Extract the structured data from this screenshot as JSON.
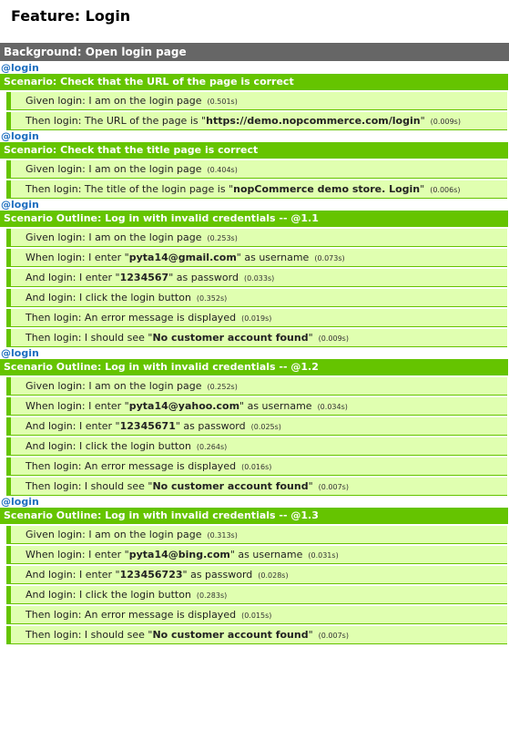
{
  "feature": {
    "title": "Feature: Login"
  },
  "background": {
    "title": "Background: Open login page"
  },
  "scenarios": [
    {
      "tag": "@login",
      "title": "Scenario: Check that the URL of the page is correct",
      "steps": [
        {
          "pre": "Given login: I am on the login page",
          "arg": "",
          "post": "",
          "duration": "(0.501s)"
        },
        {
          "pre": "Then login: The URL of the page is \"",
          "arg": "https://demo.nopcommerce.com/login",
          "post": "\"",
          "duration": "(0.009s)"
        }
      ]
    },
    {
      "tag": "@login",
      "title": "Scenario: Check that the title page is correct",
      "steps": [
        {
          "pre": "Given login: I am on the login page",
          "arg": "",
          "post": "",
          "duration": "(0.404s)"
        },
        {
          "pre": "Then login: The title of the login page is \"",
          "arg": "nopCommerce demo store. Login",
          "post": "\"",
          "duration": "(0.006s)"
        }
      ]
    },
    {
      "tag": "@login",
      "title": "Scenario Outline: Log in with invalid credentials -- @1.1",
      "steps": [
        {
          "pre": "Given login: I am on the login page",
          "arg": "",
          "post": "",
          "duration": "(0.253s)"
        },
        {
          "pre": "When login: I enter \"",
          "arg": "pyta14@gmail.com",
          "post": "\" as username",
          "duration": "(0.073s)"
        },
        {
          "pre": "And login: I enter \"",
          "arg": "1234567",
          "post": "\" as password",
          "duration": "(0.033s)"
        },
        {
          "pre": "And login: I click the login button",
          "arg": "",
          "post": "",
          "duration": "(0.352s)"
        },
        {
          "pre": "Then login: An error message is displayed",
          "arg": "",
          "post": "",
          "duration": "(0.019s)"
        },
        {
          "pre": "Then login: I should see \"",
          "arg": "No customer account found",
          "post": "\"",
          "duration": "(0.009s)"
        }
      ]
    },
    {
      "tag": "@login",
      "title": "Scenario Outline: Log in with invalid credentials -- @1.2",
      "steps": [
        {
          "pre": "Given login: I am on the login page",
          "arg": "",
          "post": "",
          "duration": "(0.252s)"
        },
        {
          "pre": "When login: I enter \"",
          "arg": "pyta14@yahoo.com",
          "post": "\" as username",
          "duration": "(0.034s)"
        },
        {
          "pre": "And login: I enter \"",
          "arg": "12345671",
          "post": "\" as password",
          "duration": "(0.025s)"
        },
        {
          "pre": "And login: I click the login button",
          "arg": "",
          "post": "",
          "duration": "(0.264s)"
        },
        {
          "pre": "Then login: An error message is displayed",
          "arg": "",
          "post": "",
          "duration": "(0.016s)"
        },
        {
          "pre": "Then login: I should see \"",
          "arg": "No customer account found",
          "post": "\"",
          "duration": "(0.007s)"
        }
      ]
    },
    {
      "tag": "@login",
      "title": "Scenario Outline: Log in with invalid credentials -- @1.3",
      "steps": [
        {
          "pre": "Given login: I am on the login page",
          "arg": "",
          "post": "",
          "duration": "(0.313s)"
        },
        {
          "pre": "When login: I enter \"",
          "arg": "pyta14@bing.com",
          "post": "\" as username",
          "duration": "(0.031s)"
        },
        {
          "pre": "And login: I enter \"",
          "arg": "123456723",
          "post": "\" as password",
          "duration": "(0.028s)"
        },
        {
          "pre": "And login: I click the login button",
          "arg": "",
          "post": "",
          "duration": "(0.283s)"
        },
        {
          "pre": "Then login: An error message is displayed",
          "arg": "",
          "post": "",
          "duration": "(0.015s)"
        },
        {
          "pre": "Then login: I should see \"",
          "arg": "No customer account found",
          "post": "\"",
          "duration": "(0.007s)"
        }
      ]
    }
  ],
  "colors": {
    "passed_header": "#65c400",
    "passed_step_bg": "#e0ffb0",
    "background_bar": "#666666",
    "tag": "#1f6fbf"
  }
}
